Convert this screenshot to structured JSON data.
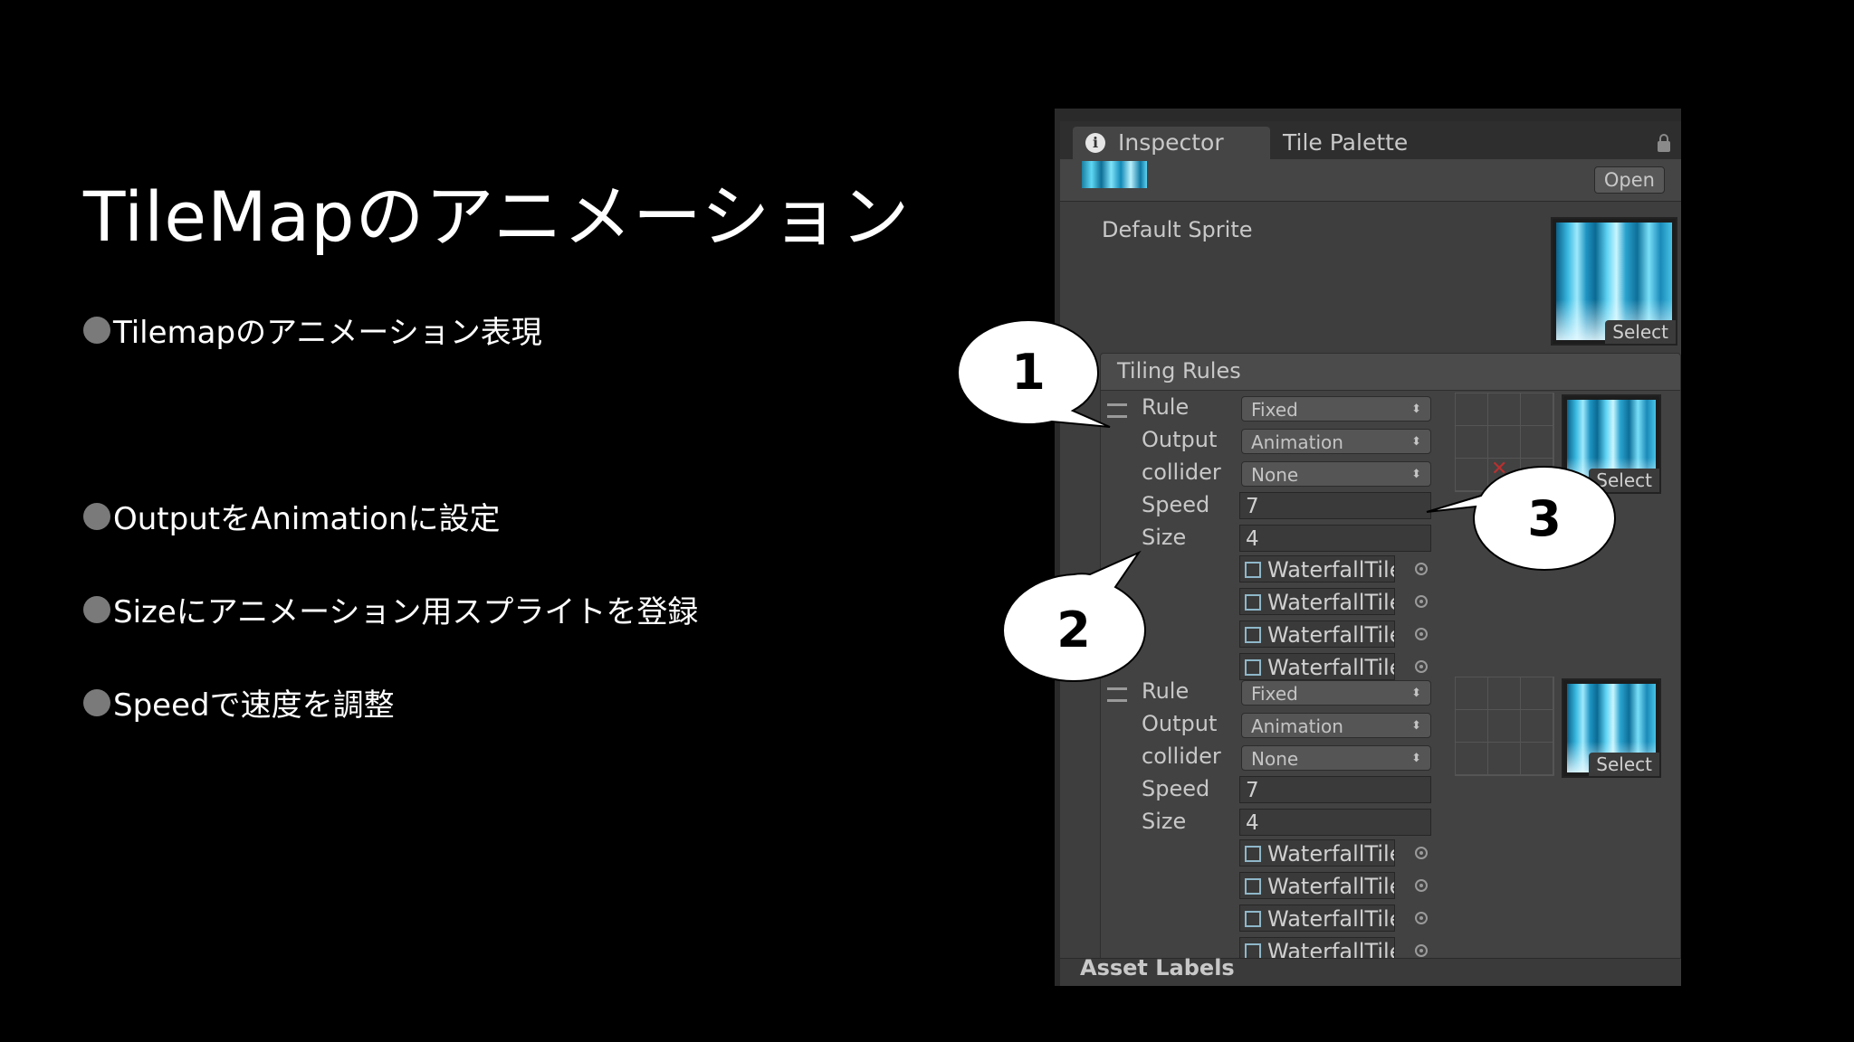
{
  "slide": {
    "title": "TileMapのアニメーション",
    "bullets": [
      "Tilemapのアニメーション表現",
      "OutputをAnimationに設定",
      "Sizeにアニメーション用スプライトを登録",
      "Speedで速度を調整"
    ]
  },
  "inspector": {
    "tabs": [
      "Inspector",
      "Tile Palette"
    ],
    "open_button": "Open",
    "default_sprite_label": "Default Sprite",
    "select_label": "Select",
    "tiling_rules_label": "Tiling Rules",
    "field_labels": {
      "rule": "Rule",
      "output": "Output",
      "collider": "collider",
      "speed": "Speed",
      "size": "Size"
    },
    "rules": [
      {
        "rule": "Fixed",
        "output": "Animation",
        "collider": "None",
        "speed": "7",
        "size": "4",
        "sprites": [
          "WaterfallTile",
          "WaterfallTile",
          "WaterfallTile",
          "WaterfallTile"
        ]
      },
      {
        "rule": "Fixed",
        "output": "Animation",
        "collider": "None",
        "speed": "7",
        "size": "4",
        "sprites": [
          "WaterfallTile",
          "WaterfallTile",
          "WaterfallTile",
          "WaterfallTile"
        ]
      }
    ],
    "asset_labels": "Asset Labels"
  },
  "callouts": [
    "1",
    "2",
    "3"
  ]
}
